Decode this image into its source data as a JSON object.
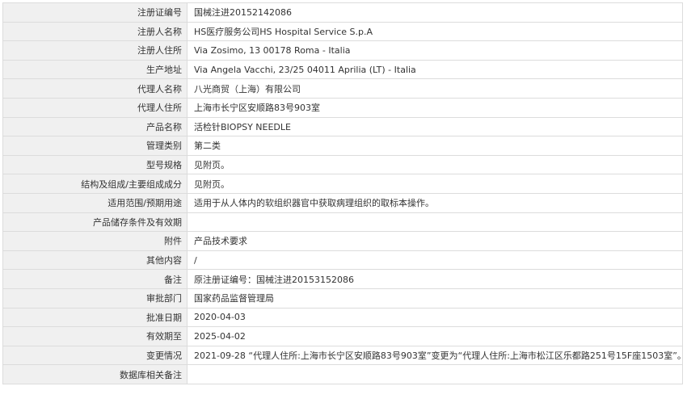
{
  "record": {
    "rows": [
      {
        "label": "注册证编号",
        "value": "国械注进20152142086"
      },
      {
        "label": "注册人名称",
        "value": "HS医疗服务公司HS Hospital Service S.p.A"
      },
      {
        "label": "注册人住所",
        "value": "Via Zosimo, 13 00178 Roma - Italia"
      },
      {
        "label": "生产地址",
        "value": "Via Angela Vacchi, 23/25 04011 Aprilia (LT) - Italia"
      },
      {
        "label": "代理人名称",
        "value": "八光商贸（上海）有限公司"
      },
      {
        "label": "代理人住所",
        "value": "上海市长宁区安顺路83号903室"
      },
      {
        "label": "产品名称",
        "value": "活检针BIOPSY NEEDLE"
      },
      {
        "label": "管理类别",
        "value": "第二类"
      },
      {
        "label": "型号规格",
        "value": "见附页。"
      },
      {
        "label": "结构及组成/主要组成成分",
        "value": "见附页。"
      },
      {
        "label": "适用范围/预期用途",
        "value": "适用于从人体内的软组织器官中获取病理组织的取标本操作。"
      },
      {
        "label": "产品储存条件及有效期",
        "value": ""
      },
      {
        "label": "附件",
        "value": "产品技术要求"
      },
      {
        "label": "其他内容",
        "value": "/"
      },
      {
        "label": "备注",
        "value": "原注册证编号：国械注进20153152086"
      },
      {
        "label": "审批部门",
        "value": "国家药品监督管理局"
      },
      {
        "label": "批准日期",
        "value": "2020-04-03"
      },
      {
        "label": "有效期至",
        "value": "2025-04-02"
      },
      {
        "label": "变更情况",
        "value": "2021-09-28 “代理人住所:上海市长宁区安顺路83号903室”变更为“代理人住所:上海市松江区乐都路251号15F座1503室”。"
      },
      {
        "label": "数据库相关备注",
        "value": ""
      }
    ]
  }
}
